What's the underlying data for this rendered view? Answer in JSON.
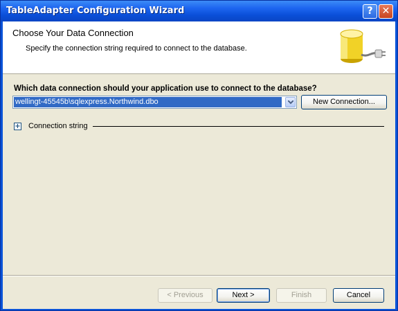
{
  "window": {
    "title": "TableAdapter Configuration Wizard",
    "help_glyph": "?",
    "close_glyph": "✕"
  },
  "header": {
    "title": "Choose Your Data Connection",
    "description": "Specify the connection string required to connect to the database.",
    "icon": "database-plug-icon"
  },
  "connection": {
    "question": "Which data connection should your application use to connect to the database?",
    "selected": "wellingt-45545b\\sqlexpress.Northwind.dbo",
    "new_button": "New Connection...",
    "expander_glyph": "+",
    "connection_string_label": "Connection string"
  },
  "footer": {
    "previous": "< Previous",
    "next": "Next >",
    "finish": "Finish",
    "cancel": "Cancel"
  },
  "colors": {
    "titlebar": "#0a4fd8",
    "client": "#ece9d8",
    "selection": "#316ac5"
  }
}
